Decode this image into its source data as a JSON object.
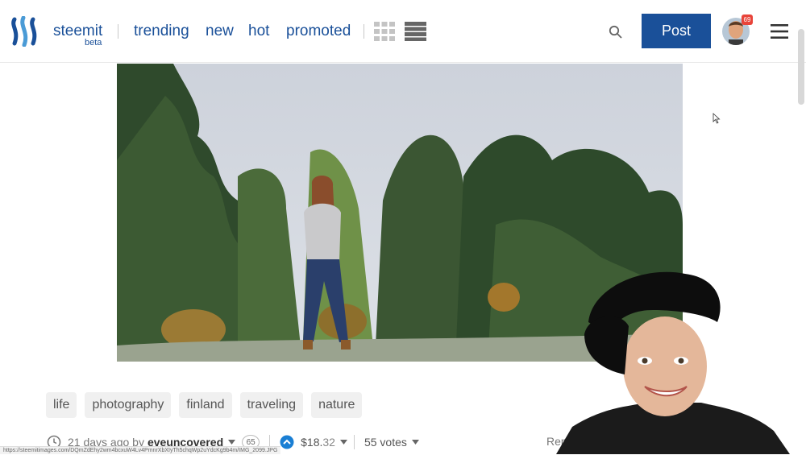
{
  "header": {
    "brand": "steemit",
    "brand_sub": "beta",
    "nav": [
      "trending",
      "new",
      "hot",
      "promoted"
    ],
    "post_label": "Post",
    "notification_count": "69"
  },
  "post": {
    "tags": [
      "life",
      "photography",
      "finland",
      "traveling",
      "nature"
    ],
    "time_ago": "21 days ago by",
    "author": "eveuncovered",
    "reputation": "65",
    "payout_main": "$18.",
    "payout_cents": "32",
    "votes": "55 votes",
    "reply_label": "Reply"
  },
  "status_bar": {
    "url": "https://steemitimages.com/DQmZdEhy2wm4bcxuW4Lv4PmnrXbXIyTh5chqWp2uYdcKg9b4m/IMG_2099.JPG"
  },
  "colors": {
    "brand_blue": "#1a5099",
    "badge_red": "#e8443a",
    "tag_bg": "#f0f0f0"
  }
}
